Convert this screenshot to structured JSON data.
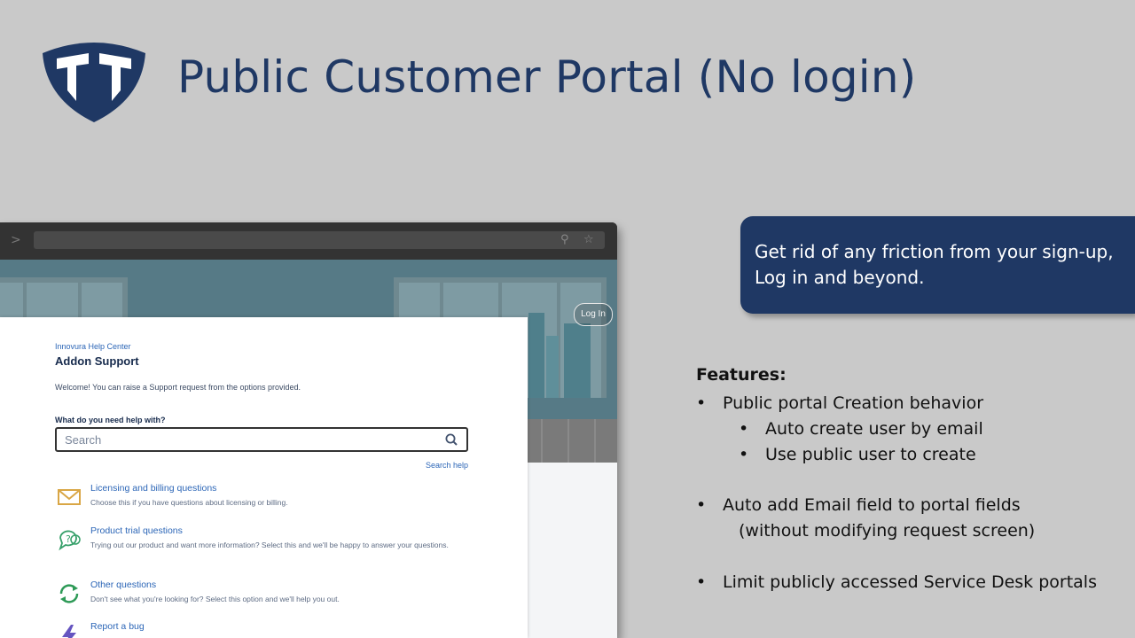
{
  "slide": {
    "title": "Public Customer Portal (No login)"
  },
  "browser": {
    "login_label": "Log In"
  },
  "portal": {
    "breadcrumb": "Innovura Help Center",
    "title": "Addon Support",
    "welcome": "Welcome! You can raise a Support request from the options provided.",
    "help_label": "What do you need help with?",
    "search_placeholder": "Search",
    "search_help": "Search help",
    "items": [
      {
        "title": "Licensing and billing questions",
        "desc": "Choose this if you have questions about licensing or billing.",
        "icon": "envelope-icon",
        "color": "#d9a645"
      },
      {
        "title": "Product trial questions",
        "desc": "Trying out our product and want more information? Select this and we'll be happy to answer your questions.",
        "icon": "question-bubble-icon",
        "color": "#36a06a"
      },
      {
        "title": "Other questions",
        "desc": "Don't see what you're looking for? Select this option and we'll help you out.",
        "icon": "refresh-icon",
        "color": "#2e9a57"
      },
      {
        "title": "Report a bug",
        "desc": "",
        "icon": "lightning-icon",
        "color": "#6554c0"
      }
    ]
  },
  "callout": {
    "text": "Get rid of any friction from your sign-up, Log in and beyond."
  },
  "features": {
    "heading": "Features:",
    "bullet_1": "Public portal Creation behavior",
    "sub_1": "Auto create user by email",
    "sub_2": "Use public user to create",
    "bullet_2": "Auto add Email field to portal fields",
    "bullet_2_cont": "(without modifying request screen)",
    "bullet_3": "Limit publicly accessed Service Desk portals",
    "bullet_char": "•"
  },
  "colors": {
    "brand_navy": "#1f3864",
    "link_blue": "#2c66b7",
    "hero_teal": "#567a86"
  }
}
